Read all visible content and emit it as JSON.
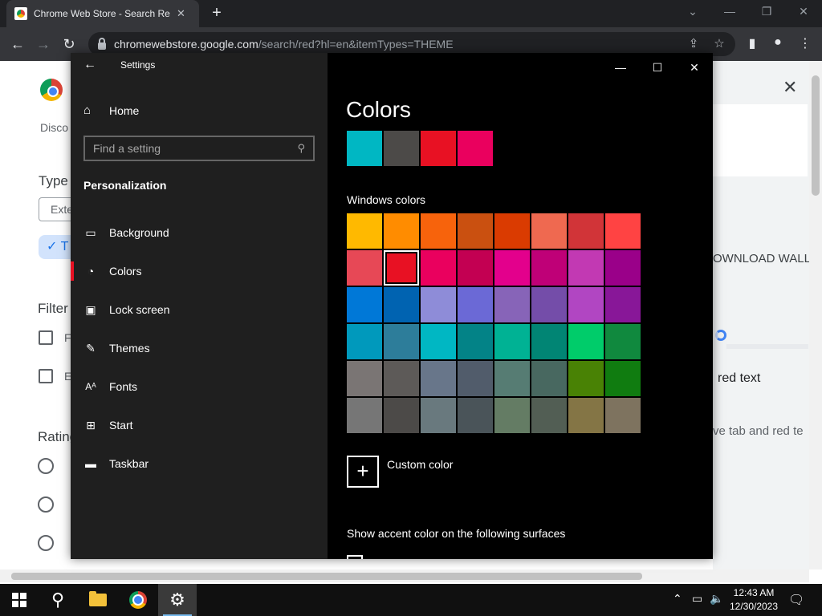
{
  "browser": {
    "tab_title": "Chrome Web Store - Search Resu",
    "url_host": "chromewebstore.google.com",
    "url_path": "/search/red?hl=en&itemTypes=THEME"
  },
  "page": {
    "discover": "Disco",
    "type_heading": "Type",
    "ext_chip": "Exte",
    "themes_chip": "T",
    "filter_heading": "Filter",
    "filter_item1": "F",
    "filter_item2": "E",
    "ratings_heading": "Rating",
    "result_title": "OWNLOAD WALL",
    "result_sub": "red text",
    "result_desc": "ve tab and red te"
  },
  "settings": {
    "title": "Settings",
    "home": "Home",
    "search_placeholder": "Find a setting",
    "section": "Personalization",
    "nav": [
      {
        "label": "Background",
        "icon": "picture-icon"
      },
      {
        "label": "Colors",
        "icon": "palette-icon"
      },
      {
        "label": "Lock screen",
        "icon": "lock-screen-icon"
      },
      {
        "label": "Themes",
        "icon": "themes-icon"
      },
      {
        "label": "Fonts",
        "icon": "fonts-icon"
      },
      {
        "label": "Start",
        "icon": "start-icon"
      },
      {
        "label": "Taskbar",
        "icon": "taskbar-icon"
      }
    ],
    "page_title": "Colors",
    "recent_colors": [
      "#00b7c3",
      "#4c4a48",
      "#e81123",
      "#ea005e"
    ],
    "windows_colors_label": "Windows colors",
    "windows_colors": [
      "#ffb900",
      "#ff8c00",
      "#f7630c",
      "#ca5010",
      "#da3b01",
      "#ef6950",
      "#d13438",
      "#ff4343",
      "#e74856",
      "#e81123",
      "#ea005e",
      "#c30052",
      "#e3008c",
      "#bf0077",
      "#c239b3",
      "#9a0089",
      "#0078d7",
      "#0063b1",
      "#8e8cd8",
      "#6b69d6",
      "#8764b8",
      "#744da9",
      "#b146c2",
      "#881798",
      "#0099bc",
      "#2d7d9a",
      "#00b7c3",
      "#038387",
      "#00b294",
      "#018574",
      "#00cc6a",
      "#10893e",
      "#7a7574",
      "#5d5a58",
      "#68768a",
      "#515c6b",
      "#567c73",
      "#486860",
      "#498205",
      "#107c10",
      "#767676",
      "#4c4a48",
      "#69797e",
      "#4a5459",
      "#647c64",
      "#525e54",
      "#847545",
      "#7e735f"
    ],
    "selected_color_index": 9,
    "custom_color_label": "Custom color",
    "show_accent_label": "Show accent color on the following surfaces"
  },
  "taskbar": {
    "time": "12:43 AM",
    "date": "12/30/2023"
  }
}
